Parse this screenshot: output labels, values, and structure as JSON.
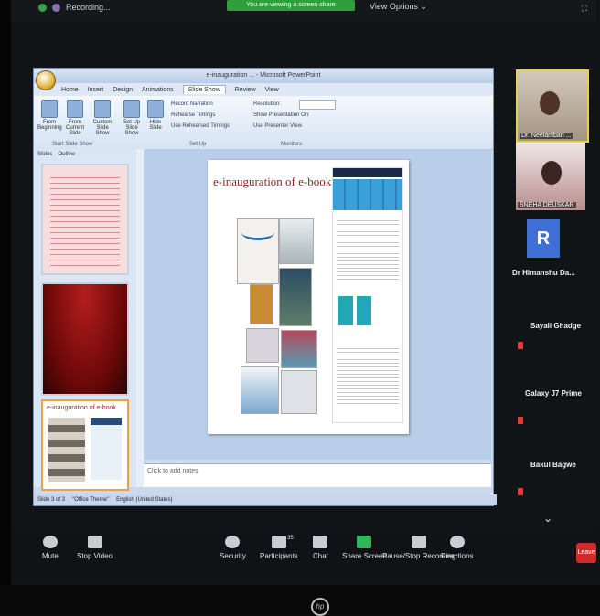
{
  "zoom_top": {
    "recording_label": "Recording...",
    "view_banner": "You are viewing a screen share",
    "view_options": "View Options ⌄"
  },
  "ppt": {
    "window_title": "e-inauguration ... - Microsoft PowerPoint",
    "tabs": [
      "Home",
      "Insert",
      "Design",
      "Animations",
      "Slide Show",
      "Review",
      "View"
    ],
    "active_tab": "Slide Show",
    "ribbon": {
      "from_beginning": "From Beginning",
      "from_current": "From Current Slide",
      "custom_show": "Custom Slide Show",
      "setup": "Set Up Slide Show",
      "hide": "Hide Slide",
      "group_start": "Start Slide Show",
      "group_setup": "Set Up",
      "group_monitors": "Monitors",
      "record_narration": "Record Narration",
      "rehearse": "Rehearse Timings",
      "use_timings": "Use Rehearsed Timings",
      "resolution": "Resolution:",
      "show_on": "Show Presentation On:",
      "presenter_view": "Use Presenter View"
    },
    "panel_tabs": [
      "Slides",
      "Outline"
    ],
    "slide_title": "e-inauguration of e-book",
    "thumb3_title": "e-inauguration of e-book",
    "notes_placeholder": "Click to add notes",
    "status": {
      "slide": "Slide 3 of 3",
      "theme": "\"Office Theme\"",
      "lang": "English (United States)"
    }
  },
  "participants": [
    {
      "name": "Dr. Neelambari ..."
    },
    {
      "name": "SNEHA DEUSKAR"
    },
    {
      "name": "Dr Himanshu Da...",
      "initial": "R"
    },
    {
      "name": "Sayali Ghadge"
    },
    {
      "name": "Galaxy J7 Prime"
    },
    {
      "name": "Bakul Bagwe"
    }
  ],
  "zoom_bar": {
    "mute": "Mute",
    "stop_video": "Stop Video",
    "security": "Security",
    "participants": "Participants",
    "participants_count": "35",
    "chat": "Chat",
    "share_screen": "Share Screen",
    "pause_recording": "Pause/Stop Recording",
    "reactions": "Reactions",
    "leave": "Leave"
  },
  "brand": "hp"
}
